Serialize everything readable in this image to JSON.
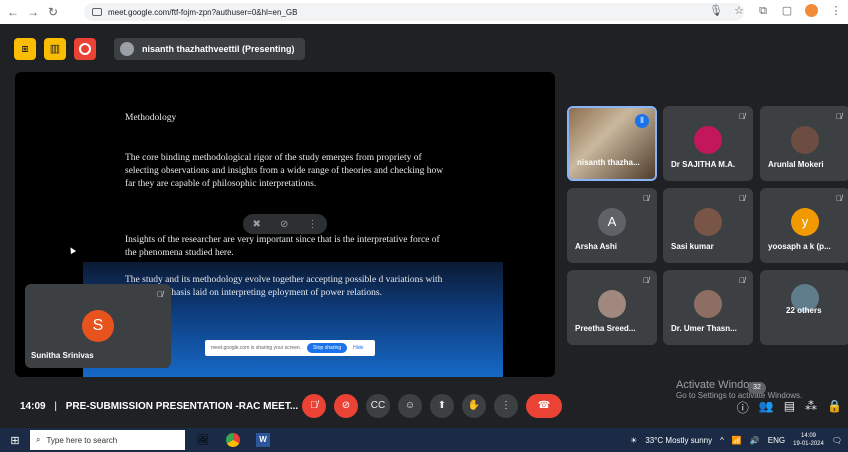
{
  "browser": {
    "url": "meet.google.com/ftf-fojm-zpn?authuser=0&hl=en_GB"
  },
  "top": {
    "presenter_chip": "nisanth thazhathveettil (Presenting)"
  },
  "slide": {
    "title": "Methodology",
    "para1": "The core binding methodological rigor of the study emerges from propriety of selecting observations and insights from a wide range of theories and checking how far they are capable of philosophic interpretations.",
    "para2": "Insights of the researcher are very important since that is the interpretative force of the phenomena studied here.",
    "para3": "The study and its methodology evolve together accepting possible d variations with the key emphasis laid on interpreting eployment of power relations.",
    "share_notice": "meet.google.com is sharing your screen.",
    "stop_sharing": "Stop sharing",
    "hide": "Hide"
  },
  "self_tile": {
    "initial": "S",
    "name": "Sunitha Srinivas"
  },
  "participants": [
    {
      "name": "nisanth thazha...",
      "type": "photo"
    },
    {
      "name": "Dr SAJITHA M.A.",
      "type": "photo"
    },
    {
      "name": "Arunlal Mokeri",
      "type": "photo"
    },
    {
      "name": "Arsha Ashi",
      "type": "initial",
      "initial": "A",
      "color": "#5f6368"
    },
    {
      "name": "Sasi kumar",
      "type": "photo"
    },
    {
      "name": "yoosaph a k (p...",
      "type": "initial",
      "initial": "y",
      "color": "#f29900"
    },
    {
      "name": "Preetha Sreed...",
      "type": "photo"
    },
    {
      "name": "Dr. Umer Thasn...",
      "type": "photo"
    },
    {
      "name": "22 others",
      "type": "group"
    }
  ],
  "bottom": {
    "time": "14:09",
    "separator": "|",
    "meeting_title": "PRE-SUBMISSION PRESENTATION -RAC MEET...",
    "participant_count": "32"
  },
  "activate": {
    "line1": "Activate Windows",
    "line2": "Go to Settings to activate Windows."
  },
  "taskbar": {
    "search_placeholder": "Type here to search",
    "weather": "33°C  Mostly sunny",
    "lang": "ENG",
    "clock_time": "14:09",
    "clock_date": "19-01-2024"
  }
}
